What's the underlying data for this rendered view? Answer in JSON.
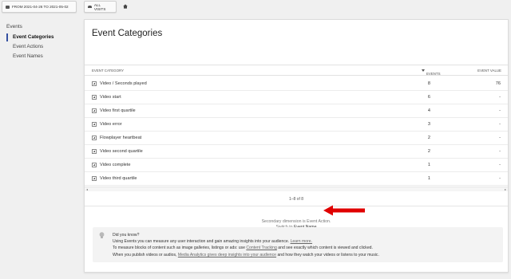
{
  "topbar": {
    "date_range": "FROM 2021-04-26 TO 2021-05-02",
    "segment": "ALL VISITS",
    "icons": {
      "calendar": "calendar-icon",
      "segment": "segment-icon",
      "home": "home-icon"
    }
  },
  "nav": {
    "heading": "Events",
    "items": [
      {
        "label": "Event Categories",
        "active": true
      },
      {
        "label": "Event Actions",
        "active": false
      },
      {
        "label": "Event Names",
        "active": false
      }
    ]
  },
  "report": {
    "title": "Event Categories",
    "columns": {
      "category": "EVENT CATEGORY",
      "events": "EVENTS",
      "value": "EVENT VALUE"
    },
    "rows": [
      {
        "label": "Video / Seconds played",
        "events": "8",
        "value": "76"
      },
      {
        "label": "Video start",
        "events": "6",
        "value": "-"
      },
      {
        "label": "Video first quartile",
        "events": "4",
        "value": "-"
      },
      {
        "label": "Video error",
        "events": "3",
        "value": "-"
      },
      {
        "label": "Flowplayer heartbeat",
        "events": "2",
        "value": "-"
      },
      {
        "label": "Video second quartile",
        "events": "2",
        "value": "-"
      },
      {
        "label": "Video complete",
        "events": "1",
        "value": "-"
      },
      {
        "label": "Video third quartile",
        "events": "1",
        "value": "-"
      }
    ],
    "pagination": "1–8 of 8",
    "secondary_dimension": "Secondary dimension is Event Action.",
    "switch_prefix": "Switch to",
    "switch_link": "Event Name"
  },
  "tip": {
    "heading": "Did you know?",
    "line1_text": "Using Events you can measure any user interaction and gain amazing insights into your audience.",
    "line1_link": "Learn more.",
    "line2_a": "To measure blocks of content such as image galleries, listings or ads: use",
    "line2_link": "Content Tracking",
    "line2_b": "and see exactly which content is viewed and clicked.",
    "line3_a": "When you publish videos or audios,",
    "line3_link": "Media Analytics gives deep insights into your audience",
    "line3_b": "and how they watch your videos or listens to your music."
  },
  "colors": {
    "accent": "#3450a1",
    "annotation_arrow": "#e00000"
  }
}
